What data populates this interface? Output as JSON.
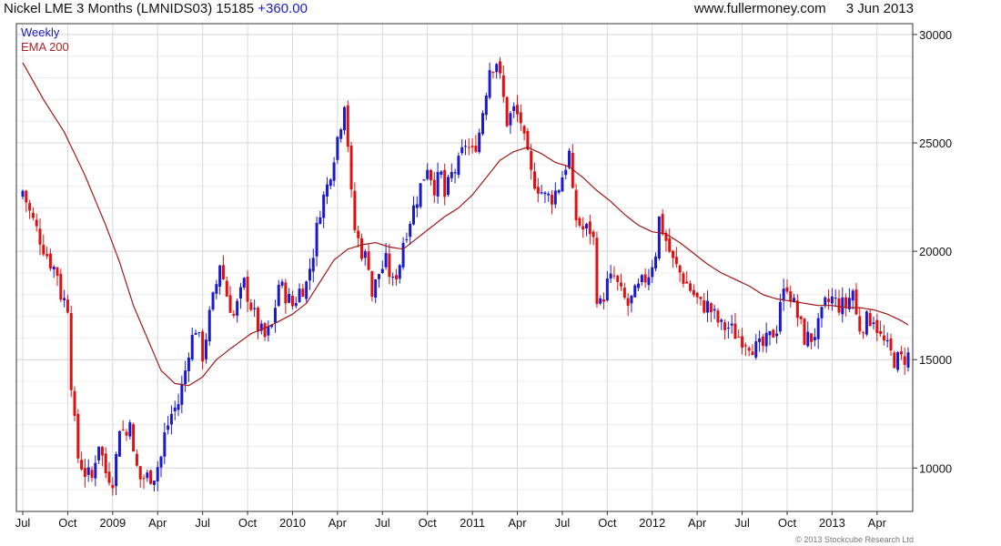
{
  "header": {
    "instrument": "Nickel LME 3 Months (LMNIDS03)",
    "last": "15185",
    "change": "+360.00",
    "source": "www.fullermoney.com",
    "date": "3 Jun 2013"
  },
  "legend": {
    "weekly": "Weekly",
    "ema": "EMA 200"
  },
  "copyright": "© 2013 Stockcube Research Ltd",
  "colors": {
    "up": "#1a1acc",
    "down": "#e01010",
    "ema": "#a01818",
    "grid": "#d8d8d8"
  },
  "chart_data": {
    "type": "candlestick",
    "frequency": "weekly",
    "y_ticks": [
      10000,
      15000,
      20000,
      25000,
      30000
    ],
    "ylim": [
      8000,
      30500
    ],
    "x_ticks": [
      "Jul",
      "Oct",
      "2009",
      "Apr",
      "Jul",
      "Oct",
      "2010",
      "Apr",
      "Jul",
      "Oct",
      "2011",
      "Apr",
      "Jul",
      "Oct",
      "2012",
      "Apr",
      "Jul",
      "Oct",
      "2013",
      "Apr"
    ],
    "x_tick_index": [
      0,
      13,
      26,
      39,
      52,
      65,
      78,
      91,
      104,
      117,
      130,
      143,
      156,
      169,
      182,
      195,
      208,
      221,
      234,
      247
    ],
    "series": [
      {
        "name": "Weekly",
        "close_path": [
          [
            0,
            22800
          ],
          [
            2,
            21800
          ],
          [
            4,
            21000
          ],
          [
            6,
            20200
          ],
          [
            8,
            19500
          ],
          [
            10,
            19000
          ],
          [
            11,
            18000
          ],
          [
            13,
            17500
          ],
          [
            14,
            14000
          ],
          [
            15,
            12000
          ],
          [
            16,
            10500
          ],
          [
            18,
            9800
          ],
          [
            20,
            9500
          ],
          [
            21,
            10500
          ],
          [
            22,
            11200
          ],
          [
            24,
            9800
          ],
          [
            26,
            9500
          ],
          [
            27,
            10500
          ],
          [
            28,
            12000
          ],
          [
            30,
            11500
          ],
          [
            31,
            12500
          ],
          [
            32,
            10500
          ],
          [
            34,
            9500
          ],
          [
            36,
            9600
          ],
          [
            38,
            9700
          ],
          [
            40,
            10500
          ],
          [
            41,
            11500
          ],
          [
            43,
            12500
          ],
          [
            45,
            13000
          ],
          [
            47,
            14500
          ],
          [
            48,
            15500
          ],
          [
            50,
            16500
          ],
          [
            52,
            15200
          ],
          [
            54,
            17000
          ],
          [
            56,
            18500
          ],
          [
            57,
            19500
          ],
          [
            59,
            18000
          ],
          [
            61,
            17000
          ],
          [
            62,
            17500
          ],
          [
            64,
            18500
          ],
          [
            66,
            17500
          ],
          [
            68,
            16500
          ],
          [
            70,
            16000
          ],
          [
            72,
            16500
          ],
          [
            74,
            18500
          ],
          [
            76,
            18000
          ],
          [
            78,
            17500
          ],
          [
            80,
            18200
          ],
          [
            82,
            18500
          ],
          [
            84,
            20000
          ],
          [
            86,
            22000
          ],
          [
            88,
            23000
          ],
          [
            90,
            24500
          ],
          [
            92,
            26000
          ],
          [
            93,
            27000
          ],
          [
            94,
            25000
          ],
          [
            95,
            22500
          ],
          [
            96,
            21000
          ],
          [
            98,
            20000
          ],
          [
            100,
            19500
          ],
          [
            101,
            18000
          ],
          [
            103,
            19000
          ],
          [
            105,
            19500
          ],
          [
            107,
            18500
          ],
          [
            109,
            19500
          ],
          [
            110,
            20500
          ],
          [
            112,
            21500
          ],
          [
            114,
            22500
          ],
          [
            116,
            23500
          ],
          [
            117,
            24000
          ],
          [
            119,
            23000
          ],
          [
            121,
            23500
          ],
          [
            122,
            22500
          ],
          [
            124,
            23500
          ],
          [
            126,
            24000
          ],
          [
            128,
            25000
          ],
          [
            130,
            24500
          ],
          [
            132,
            25500
          ],
          [
            134,
            27500
          ],
          [
            135,
            28500
          ],
          [
            137,
            28800
          ],
          [
            139,
            27000
          ],
          [
            140,
            26000
          ],
          [
            142,
            26500
          ],
          [
            144,
            26000
          ],
          [
            145,
            25000
          ],
          [
            147,
            23500
          ],
          [
            149,
            23000
          ],
          [
            151,
            22500
          ],
          [
            153,
            22500
          ],
          [
            155,
            23000
          ],
          [
            156,
            23500
          ],
          [
            158,
            24500
          ],
          [
            159,
            22500
          ],
          [
            160,
            21500
          ],
          [
            162,
            21000
          ],
          [
            164,
            21000
          ],
          [
            165,
            20500
          ],
          [
            166,
            18000
          ],
          [
            167,
            17500
          ],
          [
            169,
            18500
          ],
          [
            171,
            18800
          ],
          [
            173,
            18000
          ],
          [
            175,
            17500
          ],
          [
            177,
            18000
          ],
          [
            179,
            18500
          ],
          [
            181,
            19000
          ],
          [
            183,
            20000
          ],
          [
            184,
            21500
          ],
          [
            185,
            21000
          ],
          [
            186,
            20500
          ],
          [
            188,
            19500
          ],
          [
            190,
            19000
          ],
          [
            192,
            18500
          ],
          [
            194,
            18000
          ],
          [
            196,
            17500
          ],
          [
            198,
            17500
          ],
          [
            200,
            17000
          ],
          [
            202,
            16500
          ],
          [
            204,
            16500
          ],
          [
            206,
            16200
          ],
          [
            208,
            16000
          ],
          [
            210,
            15800
          ],
          [
            212,
            15500
          ],
          [
            214,
            15600
          ],
          [
            216,
            16000
          ],
          [
            218,
            16500
          ],
          [
            219,
            17800
          ],
          [
            220,
            18000
          ],
          [
            221,
            18500
          ],
          [
            222,
            18000
          ],
          [
            224,
            17000
          ],
          [
            226,
            16000
          ],
          [
            228,
            16000
          ],
          [
            230,
            16500
          ],
          [
            232,
            17500
          ],
          [
            234,
            17800
          ],
          [
            236,
            17500
          ],
          [
            238,
            17500
          ],
          [
            240,
            18200
          ],
          [
            241,
            17000
          ],
          [
            242,
            16500
          ],
          [
            244,
            16800
          ],
          [
            246,
            17000
          ],
          [
            248,
            16000
          ],
          [
            250,
            15500
          ],
          [
            252,
            15000
          ],
          [
            254,
            15000
          ],
          [
            256,
            15185
          ]
        ]
      },
      {
        "name": "EMA 200",
        "path": [
          [
            0,
            28700
          ],
          [
            6,
            27000
          ],
          [
            12,
            25500
          ],
          [
            18,
            23500
          ],
          [
            24,
            21200
          ],
          [
            28,
            19500
          ],
          [
            32,
            17500
          ],
          [
            36,
            16000
          ],
          [
            40,
            14500
          ],
          [
            44,
            13900
          ],
          [
            48,
            13800
          ],
          [
            52,
            14200
          ],
          [
            56,
            15000
          ],
          [
            60,
            15500
          ],
          [
            66,
            16200
          ],
          [
            72,
            16600
          ],
          [
            78,
            17100
          ],
          [
            82,
            17600
          ],
          [
            86,
            18600
          ],
          [
            90,
            19600
          ],
          [
            94,
            20100
          ],
          [
            98,
            20300
          ],
          [
            102,
            20400
          ],
          [
            106,
            20200
          ],
          [
            110,
            20100
          ],
          [
            114,
            20600
          ],
          [
            118,
            21100
          ],
          [
            122,
            21600
          ],
          [
            126,
            22000
          ],
          [
            130,
            22600
          ],
          [
            134,
            23400
          ],
          [
            138,
            24200
          ],
          [
            142,
            24600
          ],
          [
            146,
            24800
          ],
          [
            150,
            24500
          ],
          [
            154,
            24100
          ],
          [
            158,
            23900
          ],
          [
            162,
            23400
          ],
          [
            166,
            22800
          ],
          [
            170,
            22300
          ],
          [
            174,
            21700
          ],
          [
            178,
            21200
          ],
          [
            182,
            20900
          ],
          [
            186,
            20800
          ],
          [
            190,
            20400
          ],
          [
            194,
            19900
          ],
          [
            198,
            19400
          ],
          [
            202,
            19000
          ],
          [
            206,
            18700
          ],
          [
            210,
            18400
          ],
          [
            214,
            18000
          ],
          [
            218,
            17800
          ],
          [
            222,
            17700
          ],
          [
            226,
            17600
          ],
          [
            230,
            17500
          ],
          [
            234,
            17500
          ],
          [
            238,
            17400
          ],
          [
            242,
            17400
          ],
          [
            246,
            17300
          ],
          [
            250,
            17100
          ],
          [
            254,
            16800
          ],
          [
            256,
            16600
          ]
        ]
      }
    ]
  }
}
